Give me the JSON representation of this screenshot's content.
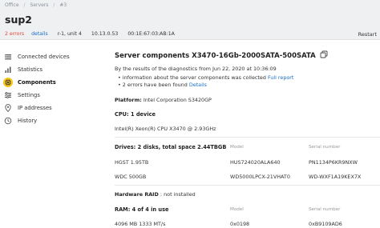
{
  "breadcrumb": {
    "items": [
      "Office",
      "Servers",
      "#3"
    ]
  },
  "header": {
    "title": "sup2",
    "errors": "2 errors",
    "details": "details",
    "location": "r-1, unit 4",
    "ip": "10.13.0.53",
    "mac": "00:1E:67:03:AB:1A",
    "restart": "Restart"
  },
  "sidebar": {
    "items": [
      {
        "label": "Connected devices",
        "icon": "connected-devices-icon"
      },
      {
        "label": "Statistics",
        "icon": "statistics-icon"
      },
      {
        "label": "Components",
        "icon": "components-icon",
        "active": true
      },
      {
        "label": "Settings",
        "icon": "settings-icon"
      },
      {
        "label": "IP addresses",
        "icon": "ip-addresses-icon"
      },
      {
        "label": "History",
        "icon": "history-icon"
      }
    ]
  },
  "main": {
    "title": "Server components X3470-16Gb-2000SATA-500SATA",
    "results_text": "By the results of the diagnostics from Jun 22, 2020 at 10:36:09",
    "bullet1_text": "• information about the server components was collected",
    "bullet1_link": "Full report",
    "bullet2_text": "• 2 errors have been found",
    "bullet2_link": "Details",
    "platform_label": "Platform:",
    "platform_value": "Intel Corporation S3420GP",
    "cpu_heading": "CPU: 1 device",
    "cpu_value": "Intel(R) Xeon(R) CPU X3470 @ 2.93GHz",
    "drives": {
      "heading": "Drives: 2 disks, total space 2.44TBGB",
      "col_model": "Model",
      "col_serial": "Serial number",
      "rows": [
        {
          "name": "HGST 1.95TB",
          "model": "HUS724020ALA640",
          "serial": "PN1134P6KR9NXW"
        },
        {
          "name": "WDC 500GB",
          "model": "WD5000LPCX-21VHAT0",
          "serial": "WD-WXF1A19KEX7X"
        }
      ]
    },
    "raid_label": "Hardware RAID",
    "raid_value": ": not installed",
    "ram": {
      "heading": "RAM: 4 of 4 in use",
      "col_model": "Model",
      "col_serial": "Serial number",
      "rows": [
        {
          "name": "4096 MB 1333 MT/s",
          "model": "0x0198",
          "serial": "0xB9109AD6"
        }
      ]
    }
  },
  "colors": {
    "accent_active": "#f5c518",
    "error": "#e0463c",
    "link": "#1a6fc4",
    "header_bg": "#eef0f2"
  }
}
